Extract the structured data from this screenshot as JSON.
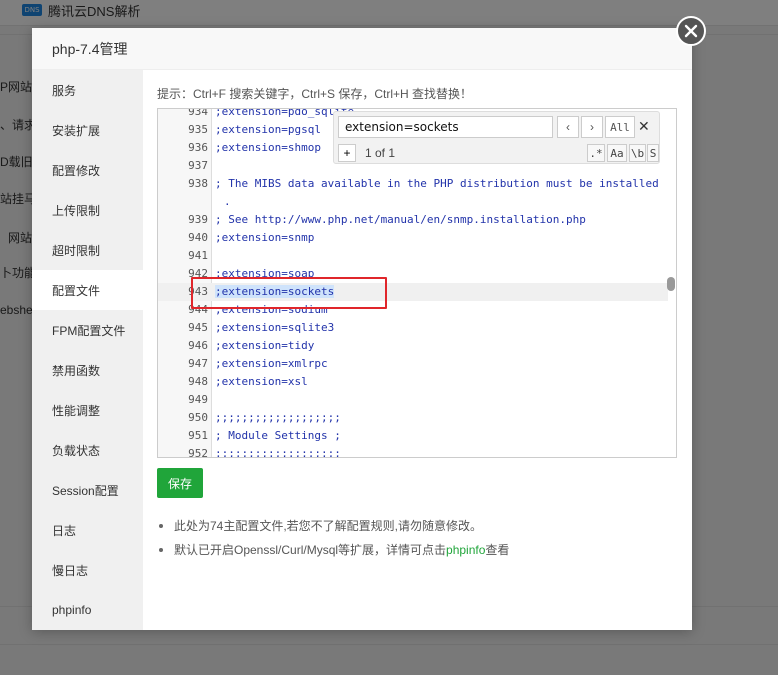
{
  "background": {
    "dns_label": "腾讯云DNS解析",
    "dns_logo": "DNS",
    "items": [
      "P网站",
      "、请求",
      "D载旧K",
      "站挂马",
      "网站",
      "卜功能",
      "ebshe"
    ]
  },
  "modal": {
    "title": "php-7.4管理",
    "sidebar": [
      {
        "label": "服务",
        "active": false
      },
      {
        "label": "安装扩展",
        "active": false
      },
      {
        "label": "配置修改",
        "active": false
      },
      {
        "label": "上传限制",
        "active": false
      },
      {
        "label": "超时限制",
        "active": false
      },
      {
        "label": "配置文件",
        "active": true
      },
      {
        "label": "FPM配置文件",
        "active": false
      },
      {
        "label": "禁用函数",
        "active": false
      },
      {
        "label": "性能调整",
        "active": false
      },
      {
        "label": "负载状态",
        "active": false
      },
      {
        "label": "Session配置",
        "active": false
      },
      {
        "label": "日志",
        "active": false
      },
      {
        "label": "慢日志",
        "active": false
      },
      {
        "label": "phpinfo",
        "active": false
      }
    ],
    "hint": "提示：Ctrl+F 搜索关键字，Ctrl+S 保存，Ctrl+H 查找替换！",
    "editor": {
      "lines": [
        {
          "no": "934",
          "text": ";extension=pdo_sqlite"
        },
        {
          "no": "935",
          "text": ";extension=pgsql"
        },
        {
          "no": "936",
          "text": ";extension=shmop"
        },
        {
          "no": "937",
          "text": ""
        },
        {
          "no": "938",
          "text": "; The MIBS data available in the PHP distribution must be installed",
          "wrap": "."
        },
        {
          "no": "939",
          "text": "; See http://www.php.net/manual/en/snmp.installation.php"
        },
        {
          "no": "940",
          "text": ";extension=snmp"
        },
        {
          "no": "941",
          "text": ""
        },
        {
          "no": "942",
          "text": ";extension=soap"
        },
        {
          "no": "943",
          "text": ";extension=sockets",
          "active": true
        },
        {
          "no": "944",
          "text": ";extension=sodium"
        },
        {
          "no": "945",
          "text": ";extension=sqlite3"
        },
        {
          "no": "946",
          "text": ";extension=tidy"
        },
        {
          "no": "947",
          "text": ";extension=xmlrpc"
        },
        {
          "no": "948",
          "text": ";extension=xsl"
        },
        {
          "no": "949",
          "text": ""
        },
        {
          "no": "950",
          "text": ";;;;;;;;;;;;;;;;;;;"
        },
        {
          "no": "951",
          "text": "; Module Settings ;"
        },
        {
          "no": "952",
          "text": ";;;;;;;;;;;;;;;;;;;"
        }
      ],
      "search": {
        "query": "extension=sockets",
        "prev": "‹",
        "next": "›",
        "all": "All",
        "close": "✕",
        "plus": "+",
        "count": "1 of 1",
        "opt_regex": ".*",
        "opt_case": "Aa",
        "opt_word": "\\b",
        "opt_sel": "S"
      }
    },
    "save_label": "保存",
    "notes": {
      "note1": "此处为74主配置文件,若您不了解配置规则,请勿随意修改。",
      "note2_prefix": "默认已开启Openssl/Curl/Mysql等扩展，详情可点击",
      "note2_link": "phpinfo",
      "note2_suffix": "查看"
    }
  },
  "colors": {
    "accent": "#20a53a",
    "highlight_box": "#e0262b",
    "code_text": "#2233aa"
  }
}
